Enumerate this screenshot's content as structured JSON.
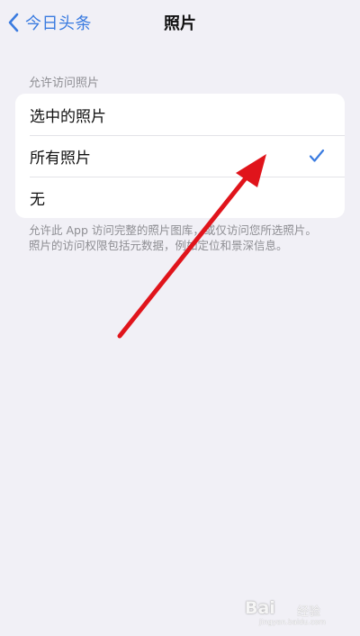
{
  "nav": {
    "back_label": "今日头条",
    "title": "照片"
  },
  "section": {
    "header": "允许访问照片",
    "options": [
      {
        "label": "选中的照片",
        "selected": false
      },
      {
        "label": "所有照片",
        "selected": true
      },
      {
        "label": "无",
        "selected": false
      }
    ],
    "footer": "允许此 App 访问完整的照片图库，或仅访问您所选照片。照片的访问权限包括元数据，例如定位和景深信息。"
  },
  "colors": {
    "accent": "#3a7be0",
    "background": "#f1f0f6",
    "annotation_arrow": "#e0141b"
  },
  "icons": {
    "back": "chevron-left-icon",
    "selected": "checkmark-icon"
  },
  "watermark": {
    "brand": "Bai",
    "brand_sub": "经验",
    "url": "jingyan.baidu.com"
  }
}
